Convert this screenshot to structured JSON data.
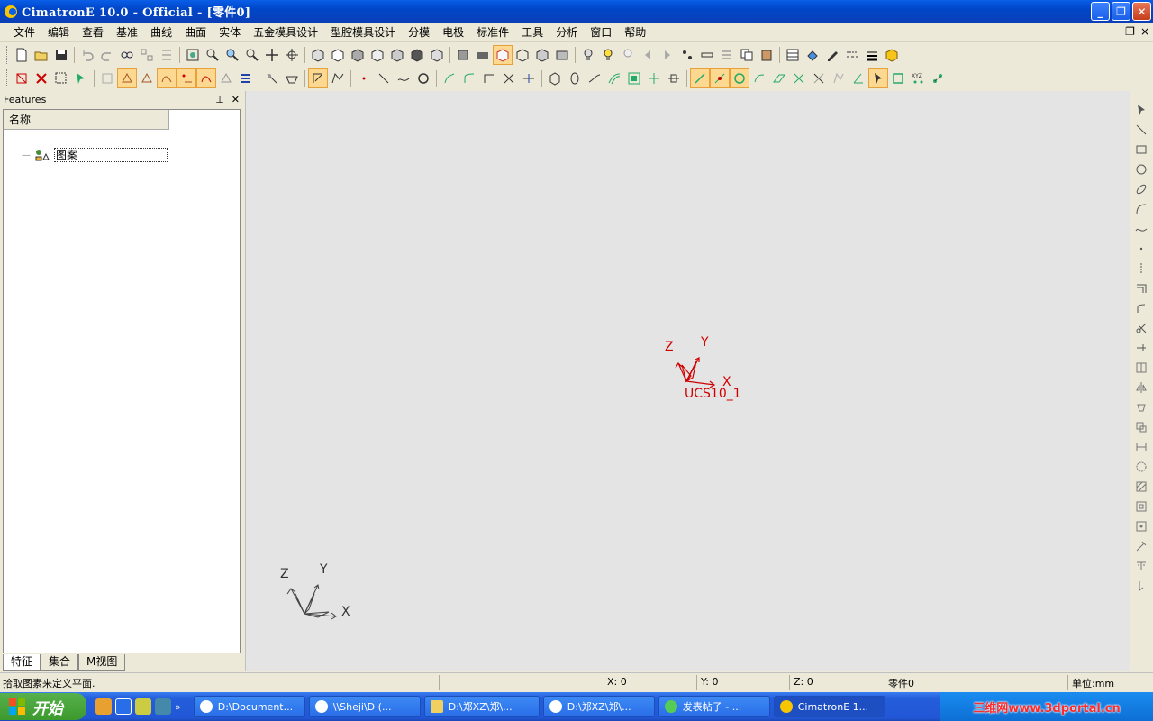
{
  "window": {
    "title": "CimatronE 10.0 - Official - [零件0]"
  },
  "menu": {
    "items": [
      "文件",
      "编辑",
      "查看",
      "基准",
      "曲线",
      "曲面",
      "实体",
      "五金模具设计",
      "型腔模具设计",
      "分模",
      "电极",
      "标准件",
      "工具",
      "分析",
      "窗口",
      "帮助"
    ]
  },
  "features": {
    "title": "Features",
    "column": "名称",
    "tree_item": "图案",
    "tabs": [
      "特征",
      "集合",
      "M视图"
    ]
  },
  "viewport": {
    "ucs": {
      "name": "UCS10_1",
      "x": "X",
      "y": "Y",
      "z": "Z"
    },
    "triad": {
      "x": "X",
      "y": "Y",
      "z": "Z"
    }
  },
  "status": {
    "message": "拾取图素来定义平面.",
    "x": "X: 0",
    "y": "Y: 0",
    "z": "Z: 0",
    "part": "零件0",
    "unit": "单位:mm"
  },
  "taskbar": {
    "start": "开始",
    "tasks": [
      "D:\\Document...",
      "\\\\Sheji\\D (...",
      "D:\\郑XZ\\郑\\...",
      "D:\\郑XZ\\郑\\...",
      "发表帖子 - ...",
      "CimatronE 1..."
    ],
    "watermark": "三维网www.3dportal.cn"
  },
  "colors": {
    "accent": "#0a5ee8",
    "ucs": "#d00000"
  }
}
